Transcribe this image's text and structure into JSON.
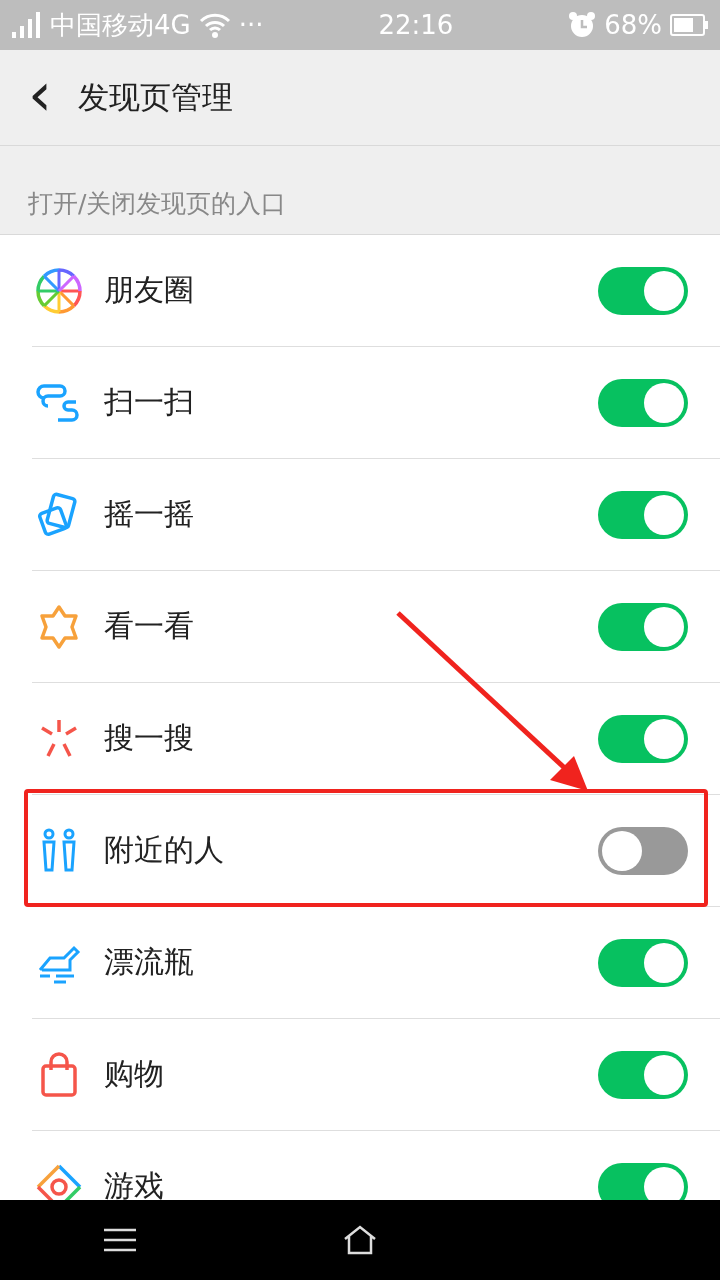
{
  "status_bar": {
    "carrier": "中国移动4G",
    "more": "···",
    "time": "22:16",
    "battery": "68%"
  },
  "header": {
    "back": "‹",
    "title": "发现页管理"
  },
  "section": {
    "label": "打开/关闭发现页的入口"
  },
  "items": [
    {
      "label": "朋友圈",
      "on": true,
      "highlighted": false
    },
    {
      "label": "扫一扫",
      "on": true,
      "highlighted": false
    },
    {
      "label": "摇一摇",
      "on": true,
      "highlighted": false
    },
    {
      "label": "看一看",
      "on": true,
      "highlighted": false
    },
    {
      "label": "搜一搜",
      "on": true,
      "highlighted": false
    },
    {
      "label": "附近的人",
      "on": false,
      "highlighted": true
    },
    {
      "label": "漂流瓶",
      "on": true,
      "highlighted": false
    },
    {
      "label": "购物",
      "on": true,
      "highlighted": false
    },
    {
      "label": "游戏",
      "on": true,
      "highlighted": false
    }
  ]
}
